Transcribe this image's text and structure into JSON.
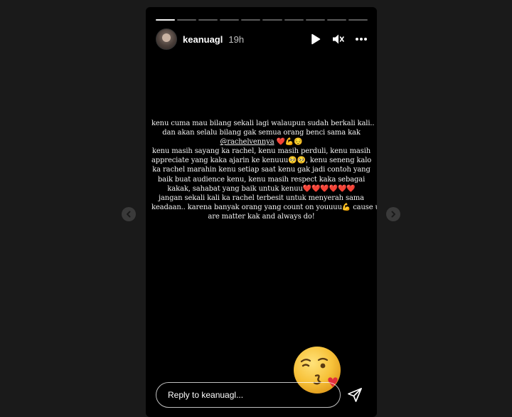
{
  "story": {
    "username": "keanuagl",
    "time": "19h",
    "progress_segments": 10,
    "progress_done": 1,
    "icons": {
      "play": "play-icon",
      "mute": "mute-icon",
      "more": "more-options-icon",
      "send": "send-icon",
      "prev": "chevron-left-icon",
      "next": "chevron-right-icon"
    },
    "text": {
      "l1": "kenu cuma mau bilang sekali lagi walaupun sudah berkali kali..",
      "l2": "dan akan selalu bilang gak semua orang benci sama kak",
      "l3_mention": "@rachelvennya",
      "l3_emojis": "❤️💪😔",
      "l4": "kenu masih sayang ka rachel, kenu masih perduli, kenu masih",
      "l5a": "appreciate yang kaka ajarin ke kenuuu",
      "l5_emojis": "🥺🥺",
      "l6a": "ka rachel marahin kenu setiap saat kenu gak jadi contoh yang",
      "l5b": ", kenu seneng kalo",
      "l7": "baik buat audience kenu, kenu masih respect kaka sebagai",
      "l8a": "kakak, sahabat yang baik untuk kenuu",
      "l8_emojis": "❤️❤️❤️❤️❤️❤️",
      "l9": "jangan sekali kali ka rachel terbesit untuk menyerah sama",
      "l10a": "keadaan.. karena banyak orang yang count on youuuu",
      "l10_emoji": "💪",
      "l10b": " cause u",
      "l11": "are matter kak and always do!"
    },
    "reply_placeholder": "Reply to keanuagl..."
  }
}
